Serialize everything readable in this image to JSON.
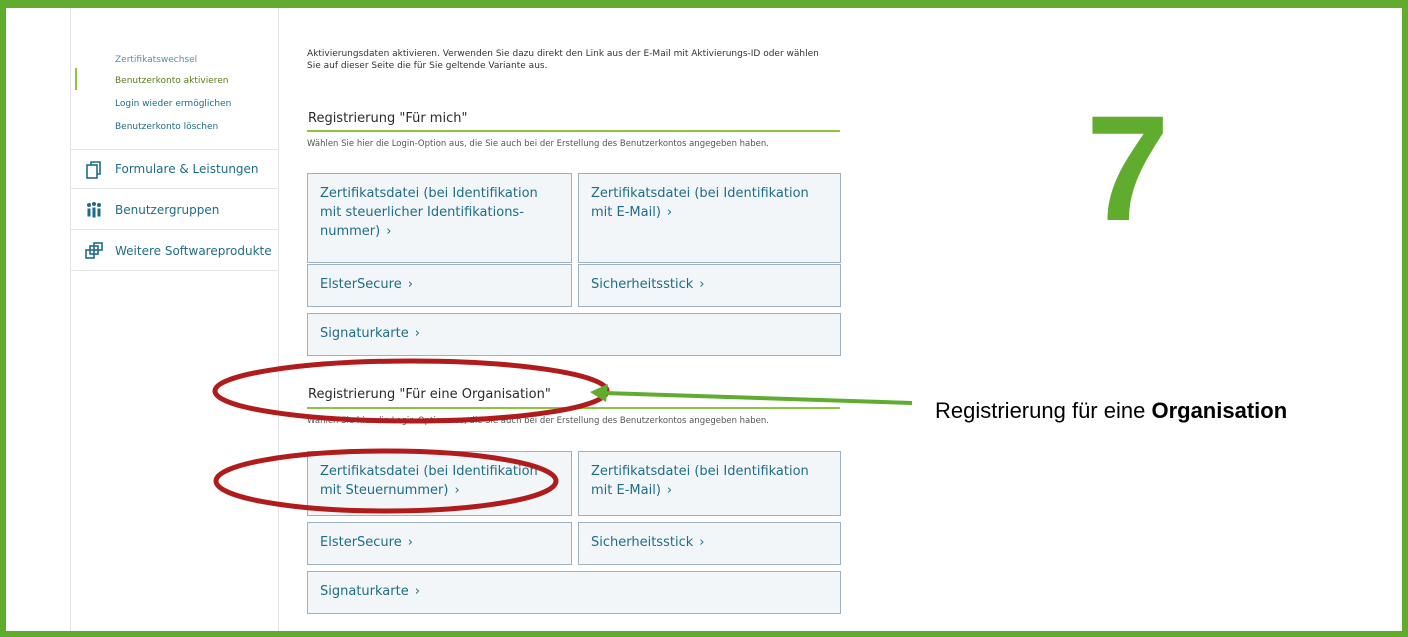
{
  "sidebar": {
    "sub_items": [
      {
        "label": "Zertifikatswechsel"
      },
      {
        "label": "Benutzerkonto aktivieren"
      },
      {
        "label": "Login wieder ermöglichen"
      },
      {
        "label": "Benutzerkonto löschen"
      }
    ],
    "nav_items": [
      {
        "label": "Formulare & Leistungen",
        "icon": "documents-icon"
      },
      {
        "label": "Benutzergruppen",
        "icon": "user-group-icon"
      },
      {
        "label": "Weitere Softwareprodukte",
        "icon": "software-products-icon"
      }
    ]
  },
  "main": {
    "intro_line1": "Aktivierungsdaten aktivieren. Verwenden Sie dazu direkt den Link aus der E-Mail mit Aktivierungs-ID oder wählen",
    "intro_line2": "Sie auf dieser Seite die für Sie geltende Variante aus.",
    "sections": [
      {
        "heading": "Registrierung \"Für mich\"",
        "description": "Wählen Sie hier die Login-Option aus, die Sie auch bei der Erstellung des Benutzerkontos angegeben haben.",
        "options": [
          {
            "label": "Zertifikatsdatei (bei Identifikation mit steuerlicher Identifikations- nummer)"
          },
          {
            "label": "Zertifikatsdatei (bei Identifikation mit E-Mail)"
          },
          {
            "label": "ElsterSecure"
          },
          {
            "label": "Sicherheitsstick"
          },
          {
            "label": "Signaturkarte"
          }
        ]
      },
      {
        "heading": "Registrierung \"Für eine Organisation\"",
        "description": "Wählen Sie hier die Login-Option aus, die Sie auch bei der Erstellung des Benutzerkontos angegeben haben.",
        "options": [
          {
            "label": "Zertifikatsdatei (bei Identifikation mit Steuernummer)"
          },
          {
            "label": "Zertifikatsdatei (bei Identifikation mit E-Mail)"
          },
          {
            "label": "ElsterSecure"
          },
          {
            "label": "Sicherheitsstick"
          },
          {
            "label": "Signaturkarte"
          }
        ]
      }
    ],
    "chevron": "›"
  },
  "annotation": {
    "step_number": "7",
    "callout_prefix": "Registrierung für eine ",
    "callout_bold": "Organisation",
    "frame_color": "#5fac2e",
    "ellipse_color": "#b01c1c"
  }
}
